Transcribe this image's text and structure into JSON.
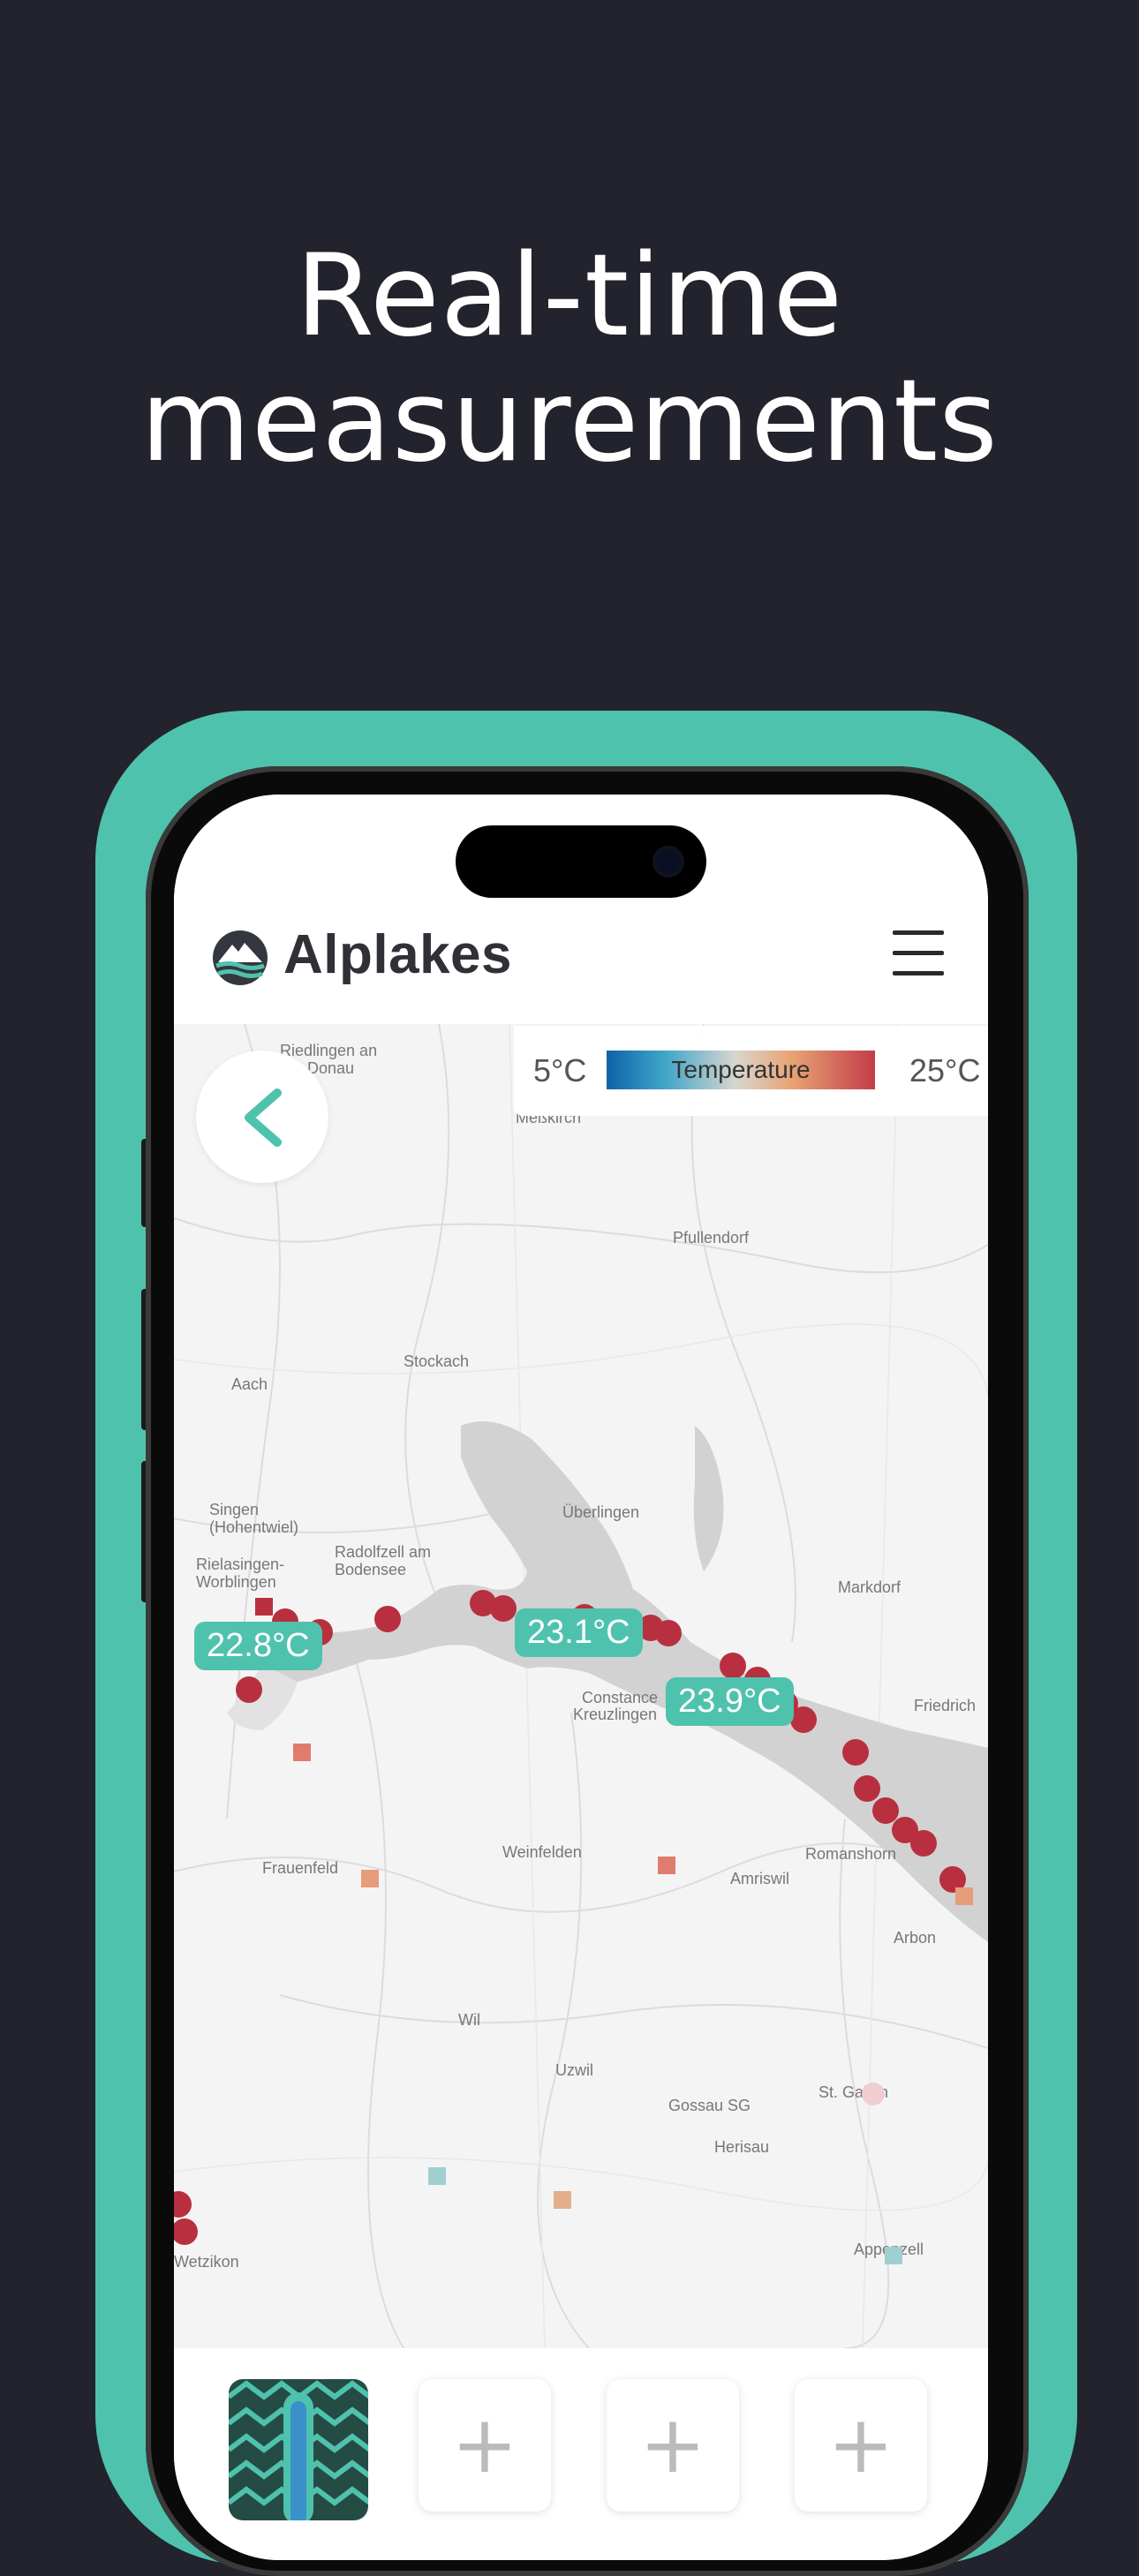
{
  "headline": {
    "line1": "Real-time",
    "line2": "measurements"
  },
  "app": {
    "logo_text": "Alplakes",
    "legend": {
      "min": "5°C",
      "label": "Temperature",
      "max": "25°C"
    }
  },
  "map": {
    "places": [
      "Riedlingen an der Donau",
      "Meßkirch",
      "Pfullendorf",
      "Aach",
      "Stockach",
      "Singen (Hohentwiel)",
      "Rielasingen-Worblingen",
      "Radolfzell am Bodensee",
      "Überlingen",
      "Markdorf",
      "Friedrich",
      "Constance",
      "Kreuzlingen",
      "Weinfelden",
      "Frauenfeld",
      "Amriswil",
      "Romanshorn",
      "Arbon",
      "Wil",
      "Uzwil",
      "Gossau SG",
      "St. Gallen",
      "Herisau",
      "Appenzell",
      "Wetzikon"
    ],
    "temperature_labels": [
      "22.8°C",
      "23.1°C",
      "23.9°C"
    ]
  },
  "bottom_slots": [
    {
      "type": "thermometer",
      "icon": "thermometer-icon"
    },
    {
      "type": "add",
      "icon": "plus-icon"
    },
    {
      "type": "add",
      "icon": "plus-icon"
    },
    {
      "type": "add",
      "icon": "plus-icon"
    }
  ],
  "colors": {
    "case": "#4fc2ad",
    "background": "#22232c",
    "marker": "#b8303f",
    "label_bg": "#4fc2ad"
  }
}
